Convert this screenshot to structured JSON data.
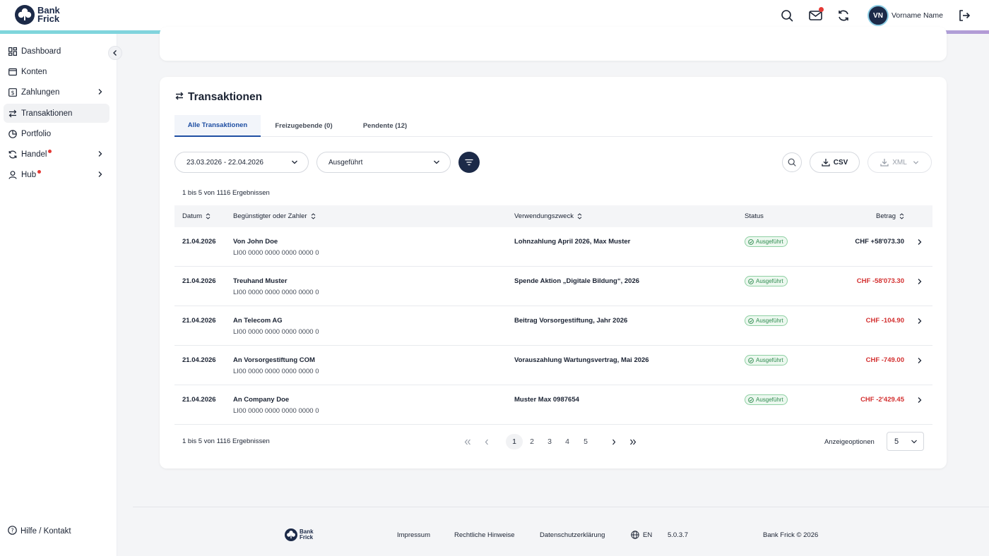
{
  "brand": {
    "line1": "Bank",
    "line2": "Frick",
    "accent": "#1c2a48"
  },
  "header": {
    "icons": [
      "search-icon",
      "mail-icon",
      "refresh-icon",
      "logout-icon"
    ],
    "user_initials": "VN",
    "user_name": "Vorname Name"
  },
  "sidebar": {
    "items": [
      {
        "label": "Dashboard",
        "icon": "dashboard-icon"
      },
      {
        "label": "Konten",
        "icon": "wallet-icon"
      },
      {
        "label": "Zahlungen",
        "icon": "payment-icon"
      },
      {
        "label": "Transaktionen",
        "icon": "transactions-icon"
      },
      {
        "label": "Portfolio",
        "icon": "pie-chart-icon"
      },
      {
        "label": "Handel",
        "icon": "trade-icon"
      },
      {
        "label": "Hub",
        "icon": "user-icon"
      }
    ],
    "help": "Hilfe / Kontakt"
  },
  "card": {
    "title": "Transaktionen",
    "tabs": [
      "Alle Transaktionen",
      "Freizugebende (0)",
      "Pendente (12)"
    ],
    "date_range": "23.03.2026 - 22.04.2026",
    "status_filter": "Ausgeführt",
    "csv": "CSV",
    "xml": "XML",
    "results": "1 bis 5 von 1116 Ergebnissen",
    "columns": [
      "Datum",
      "Begünstigter oder Zahler",
      "Verwendungszweck",
      "Status",
      "Betrag"
    ],
    "rows": [
      {
        "date": "21.04.2026",
        "name": "Von John Doe",
        "iban": "LI00 0000 0000 0000 0000 0",
        "purpose": "Lohnzahlung April 2026, Max Muster",
        "status": "Ausgeführt",
        "amount": "CHF +58'073.30",
        "type": "credit"
      },
      {
        "date": "21.04.2026",
        "name": "Treuhand Muster",
        "iban": "LI00 0000 0000 0000 0000 0",
        "purpose": "Spende Aktion „Digitale Bildung“, 2026",
        "status": "Ausgeführt",
        "amount": "CHF -58'073.30",
        "type": "debit"
      },
      {
        "date": "21.04.2026",
        "name": "An Telecom AG",
        "iban": "LI00 0000 0000 0000 0000 0",
        "purpose": "Beitrag Vorsorgestiftung, Jahr 2026",
        "status": "Ausgeführt",
        "amount": "CHF -104.90",
        "type": "debit"
      },
      {
        "date": "21.04.2026",
        "name": "An Vorsorgestiftung COM",
        "iban": "LI00 0000 0000 0000 0000 0",
        "purpose": "Vorauszahlung Wartungsvertrag, Mai 2026",
        "status": "Ausgeführt",
        "amount": "CHF -749.00",
        "type": "debit"
      },
      {
        "date": "21.04.2026",
        "name": "An Company Doe",
        "iban": "LI00 0000 0000 0000 0000 0",
        "purpose": "Muster Max 0987654",
        "status": "Ausgeführt",
        "amount": "CHF -2'429.45",
        "type": "debit"
      }
    ],
    "pages": [
      "1",
      "2",
      "3",
      "4",
      "5"
    ],
    "current_page": "1",
    "per_page_label": "Anzeigeoptionen",
    "per_page": "5",
    "colors": {
      "credit": "#1b2333",
      "debit": "#d32f2f",
      "status": "#2e8b4f"
    }
  },
  "footer": {
    "links": [
      "Impressum",
      "Rechtliche Hinweise",
      "Datenschutzerklärung"
    ],
    "lang": "EN",
    "version": "5.0.3.7",
    "copyright": "Bank Frick © 2026"
  }
}
